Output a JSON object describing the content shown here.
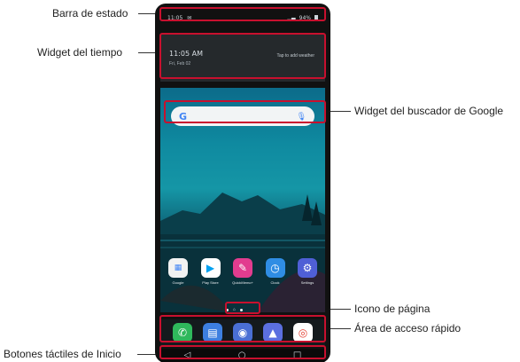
{
  "callouts": {
    "status_bar": "Barra de estado",
    "weather_widget": "Widget del tiempo",
    "google_search_widget": "Widget del buscador de Google",
    "page_icon": "Icono de página",
    "quick_access": "Área de acceso rápido",
    "home_touch_buttons": "Botones táctiles de Inicio"
  },
  "status_bar": {
    "left_text": "11:05",
    "right_text": "94%"
  },
  "weather": {
    "time": "11:05 AM",
    "date": "Fri, Feb 02",
    "action": "Tap to add weather"
  },
  "search": {
    "logo": "G",
    "mic_icon": "mic-icon"
  },
  "apps": [
    {
      "label": "Google",
      "icon": "google-folder-icon",
      "color": "#f2f2f2"
    },
    {
      "label": "Play Store",
      "icon": "play-store-icon",
      "color": "#ffffff"
    },
    {
      "label": "QuickMemo+",
      "icon": "quickmemo-icon",
      "color": "#e23c8f"
    },
    {
      "label": "Clock",
      "icon": "clock-icon",
      "color": "#2f8de4"
    },
    {
      "label": "Settings",
      "icon": "settings-icon",
      "color": "#4f5fd6"
    }
  ],
  "dock": [
    {
      "icon": "phone-icon",
      "color": "#2fb85c",
      "glyph": "✆"
    },
    {
      "icon": "messages-icon",
      "color": "#3d7fe0",
      "glyph": "▤"
    },
    {
      "icon": "camera-icon",
      "color": "#4a6fd4",
      "glyph": "◉"
    },
    {
      "icon": "gallery-icon",
      "color": "#5b6fe0",
      "glyph": "▲"
    },
    {
      "icon": "chrome-icon",
      "color": "#ffffff",
      "glyph": "◎"
    }
  ],
  "nav": {
    "back": "◁",
    "home": "○",
    "recents": "□"
  },
  "accent_color": "#c8102e"
}
